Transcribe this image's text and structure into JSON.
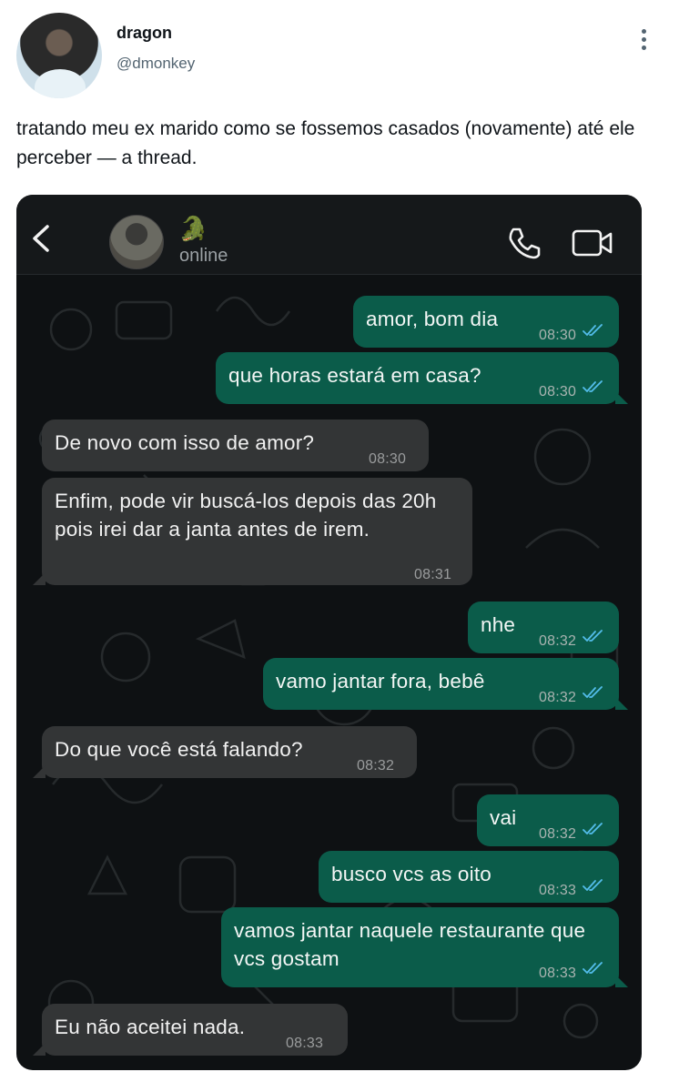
{
  "tweet": {
    "display_name": "dragon",
    "handle": "@dmonkey",
    "text": "tratando meu ex marido como se fossemos casados (novamente) até ele perceber — a thread."
  },
  "chat": {
    "contact_emoji": "🐊",
    "status": "online",
    "messages": [
      {
        "dir": "out",
        "text": "amor, bom dia",
        "time": "08:30"
      },
      {
        "dir": "out",
        "text": "que horas estará em casa?",
        "time": "08:30"
      },
      {
        "dir": "in",
        "text": "De novo com isso de amor?",
        "time": "08:30"
      },
      {
        "dir": "in",
        "text": "Enfim, pode vir buscá-los depois das 20h pois irei dar a janta antes de irem.",
        "time": "08:31"
      },
      {
        "dir": "out",
        "text": "nhe",
        "time": "08:32"
      },
      {
        "dir": "out",
        "text": "vamo jantar fora, bebê",
        "time": "08:32"
      },
      {
        "dir": "in",
        "text": "Do que você está falando?",
        "time": "08:32"
      },
      {
        "dir": "out",
        "text": "vai",
        "time": "08:32"
      },
      {
        "dir": "out",
        "text": "busco vcs as oito",
        "time": "08:33"
      },
      {
        "dir": "out",
        "text": "vamos jantar naquele restaurante que vcs gostam",
        "time": "08:33"
      },
      {
        "dir": "in",
        "text": "Eu não aceitei nada.",
        "time": "08:33"
      }
    ]
  },
  "colors": {
    "outgoing_bubble": "#0b5c4a",
    "incoming_bubble": "#333536",
    "read_ticks": "#53bdeb",
    "chat_background": "#0e1113"
  }
}
